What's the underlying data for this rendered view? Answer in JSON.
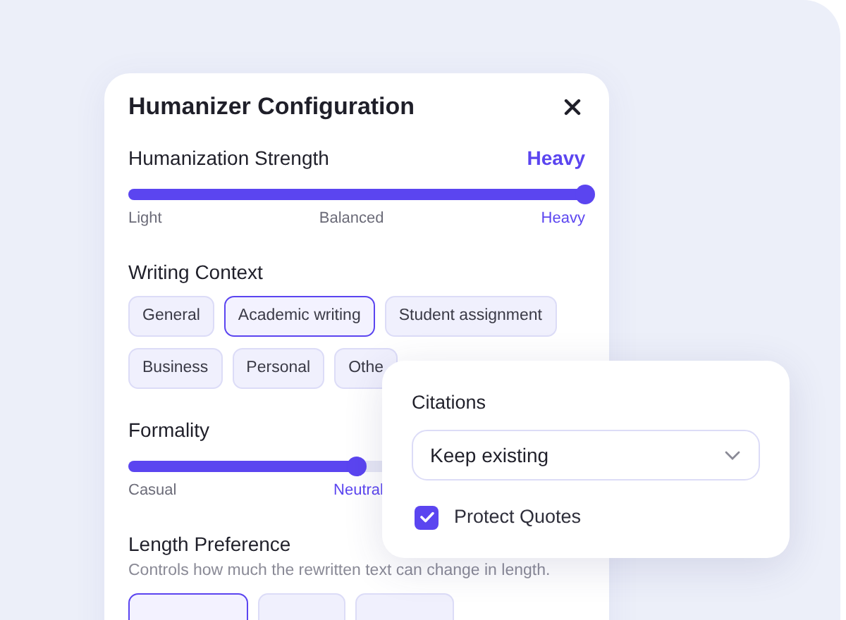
{
  "dialog": {
    "title": "Humanizer Configuration",
    "strength": {
      "label": "Humanization Strength",
      "value": "Heavy",
      "level": 1,
      "ticks": [
        {
          "label": "Light",
          "selected": false
        },
        {
          "label": "Balanced",
          "selected": false
        },
        {
          "label": "Heavy",
          "selected": true
        }
      ]
    },
    "writing_context": {
      "label": "Writing Context",
      "options": [
        {
          "label": "General",
          "selected": false
        },
        {
          "label": "Academic writing",
          "selected": true
        },
        {
          "label": "Student assignment",
          "selected": false
        },
        {
          "label": "Business",
          "selected": false
        },
        {
          "label": "Personal",
          "selected": false
        },
        {
          "label": "Othe",
          "selected": false
        }
      ]
    },
    "formality": {
      "label": "Formality",
      "level": 0.5,
      "ticks": [
        {
          "label": "Casual",
          "selected": false
        },
        {
          "label": "Neutral",
          "selected": true
        }
      ]
    },
    "length_preference": {
      "label": "Length Preference",
      "description": "Controls how much the rewritten text can change in length.",
      "options": [
        {
          "selected": true
        },
        {
          "selected": false
        },
        {
          "selected": false
        }
      ]
    }
  },
  "citations_popup": {
    "label": "Citations",
    "dropdown_value": "Keep existing",
    "protect_quotes": {
      "label": "Protect Quotes",
      "checked": true
    }
  }
}
